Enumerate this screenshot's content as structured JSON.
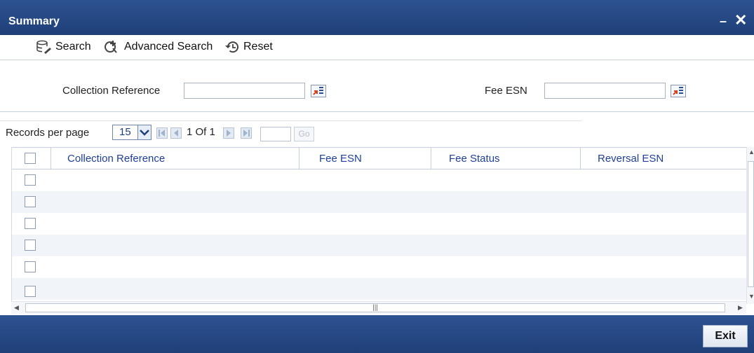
{
  "window": {
    "title": "Summary",
    "minimize_glyph": "–",
    "close_glyph": "✕"
  },
  "toolbar": {
    "search_label": "Search",
    "advanced_search_label": "Advanced Search",
    "reset_label": "Reset"
  },
  "criteria": {
    "collection_reference_label": "Collection Reference",
    "collection_reference_value": "",
    "fee_esn_label": "Fee ESN",
    "fee_esn_value": ""
  },
  "pager": {
    "records_per_page_label": "Records per page",
    "records_per_page_value": "15",
    "page_info": "1 Of 1",
    "goto_value": "",
    "go_label": "Go"
  },
  "table": {
    "columns": [
      "Collection Reference",
      "Fee ESN",
      "Fee Status",
      "Reversal ESN"
    ],
    "empty_row_count": 6
  },
  "footer": {
    "exit_label": "Exit"
  },
  "colors": {
    "header_bg": "#23478a",
    "column_header_text": "#1f3f9a"
  },
  "icons": [
    "search-icon",
    "advanced-search-icon",
    "reset-icon",
    "lov-icon",
    "first-page-icon",
    "prev-page-icon",
    "next-page-icon",
    "last-page-icon",
    "dropdown-arrow-icon"
  ]
}
